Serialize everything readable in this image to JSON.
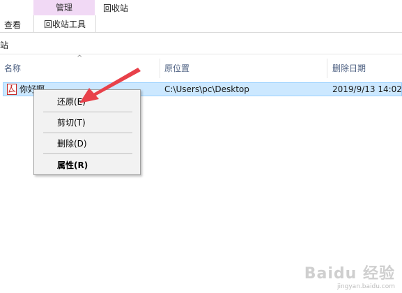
{
  "ribbon": {
    "manage_label": "管理",
    "recycle_tools_label": "回收站工具",
    "recycle_bin_tab": "回收站",
    "view_tab": "查看",
    "manage_color": "#f1d9f5"
  },
  "address": {
    "text": "站"
  },
  "columns": {
    "name": "名称",
    "original_location": "原位置",
    "date_deleted": "删除日期"
  },
  "file": {
    "name": "你好啊",
    "location": "C:\\Users\\pc\\Desktop",
    "date": "2019/9/13 14:02",
    "icon": "pdf-icon"
  },
  "context_menu": {
    "restore": "还原(E)",
    "cut": "剪切(T)",
    "delete": "删除(D)",
    "properties": "属性(R)"
  },
  "colors": {
    "selection": "#cce8ff",
    "selection_border": "#99d1ff",
    "annotation_arrow": "#e8414a"
  },
  "watermark": {
    "logo": "Baidu 经验",
    "url": "jingyan.baidu.com"
  }
}
